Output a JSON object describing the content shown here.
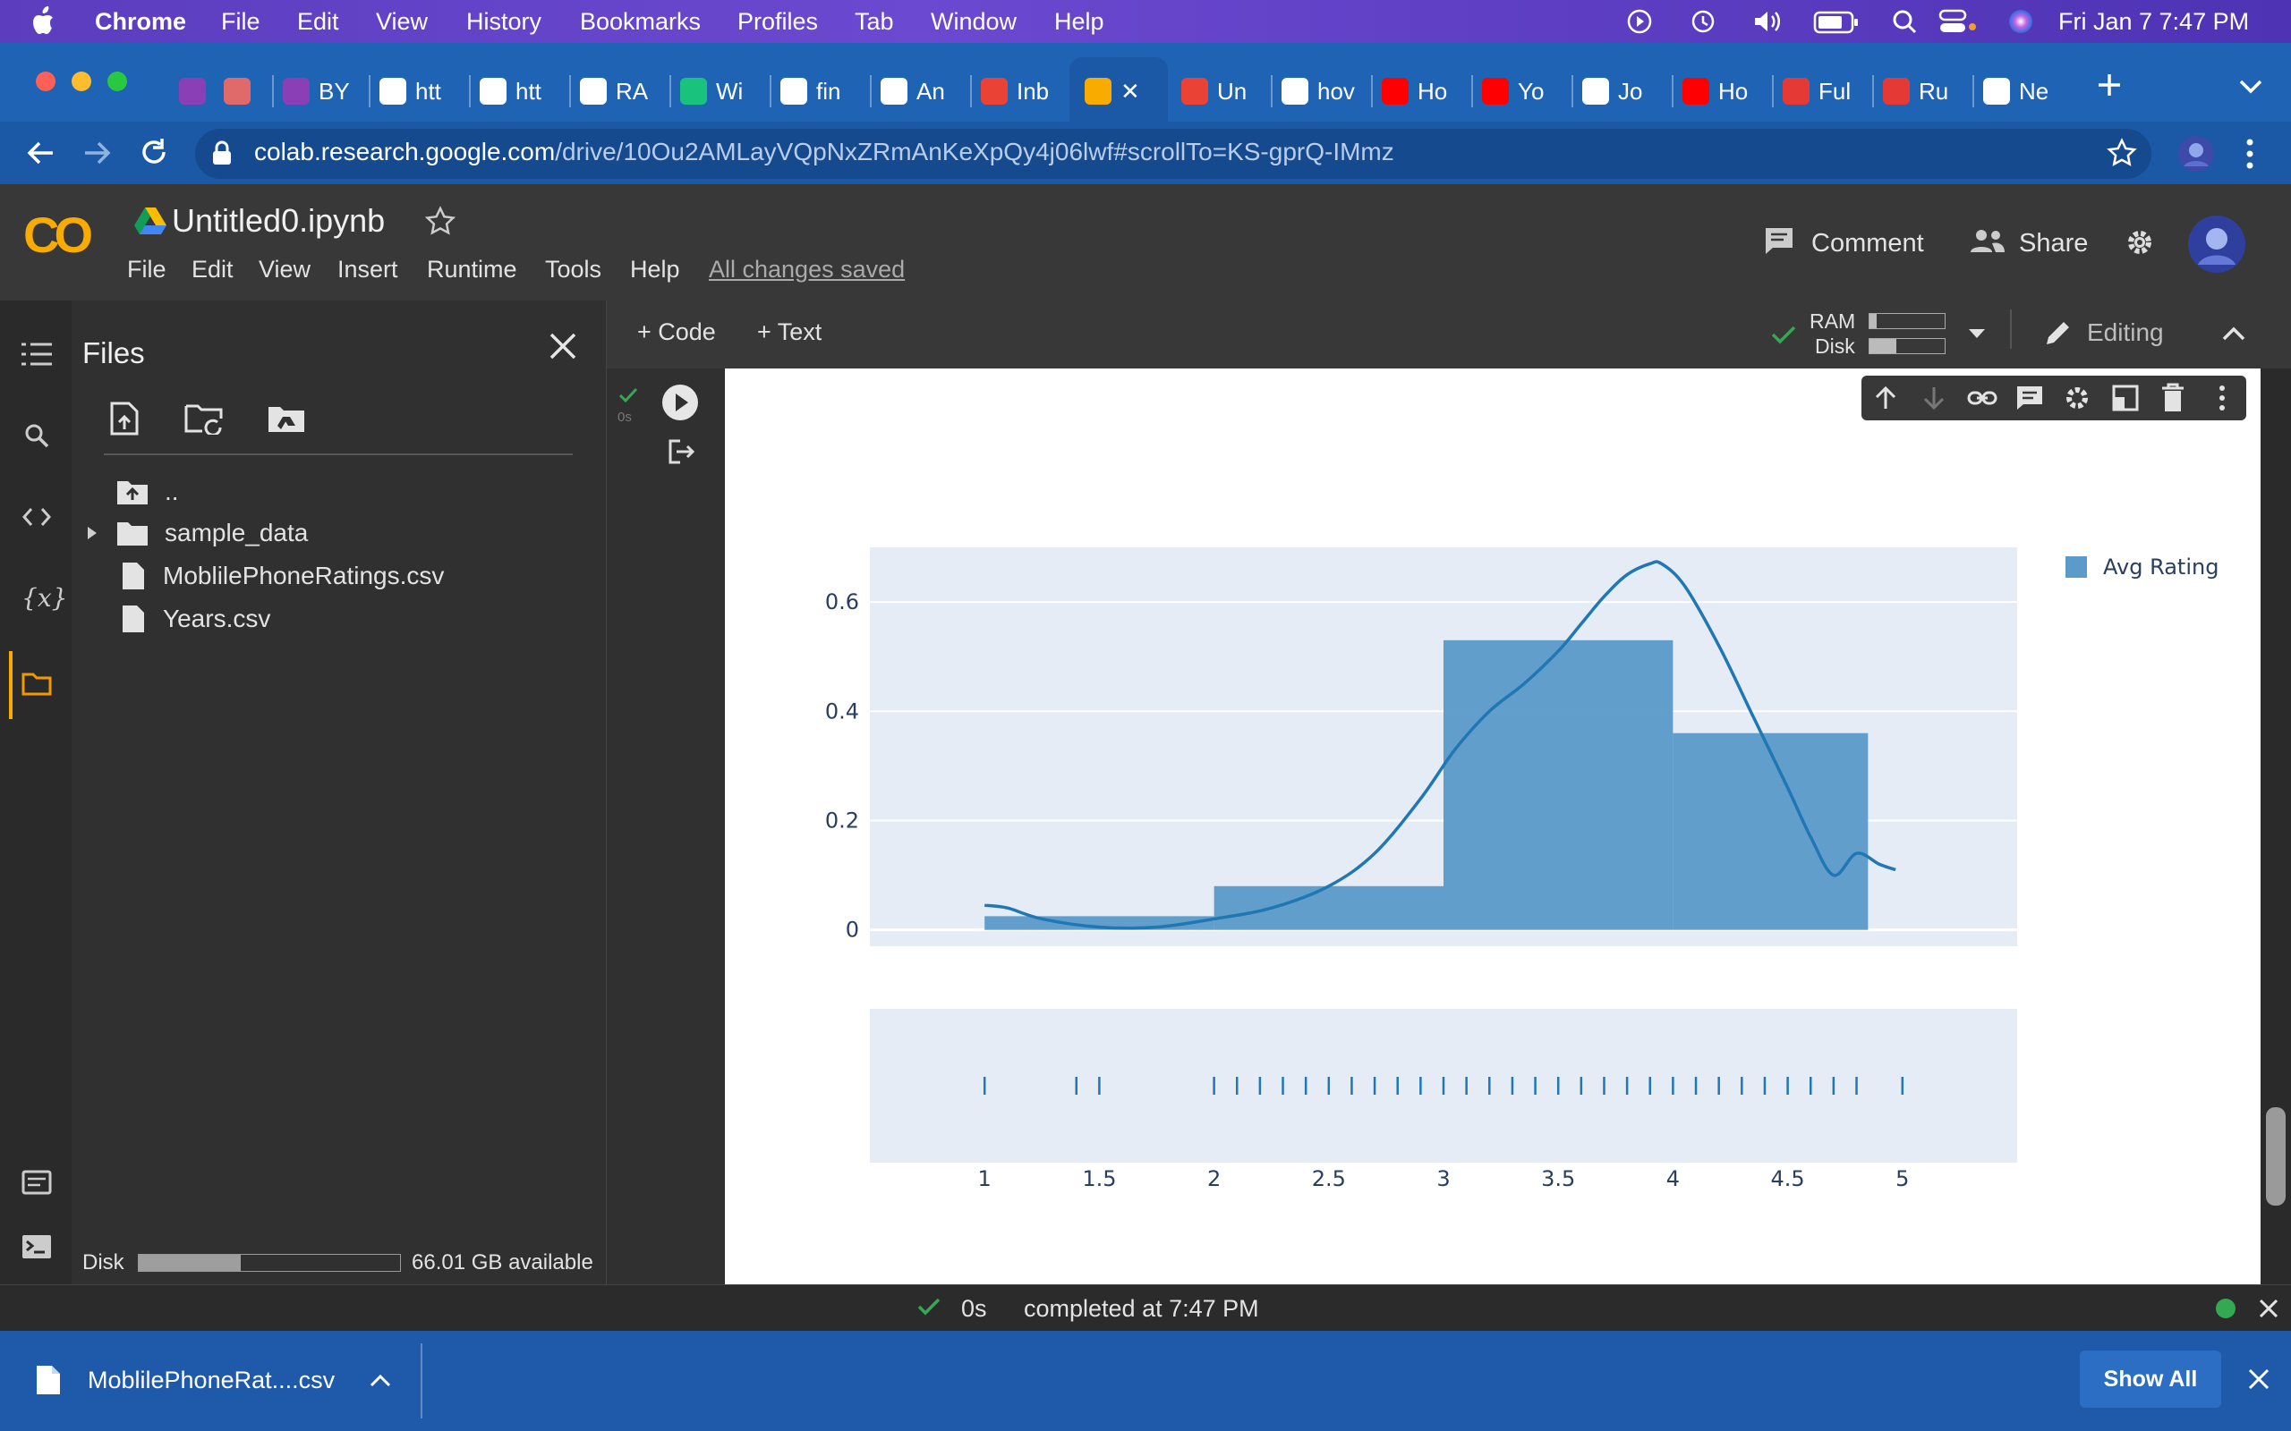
{
  "menubar": {
    "app": "Chrome",
    "items": [
      "File",
      "Edit",
      "View",
      "History",
      "Bookmarks",
      "Profiles",
      "Tab",
      "Window",
      "Help"
    ],
    "datetime": "Fri Jan 7  7:47 PM"
  },
  "tabs": [
    {
      "label": "",
      "color": "#8b3fb6"
    },
    {
      "label": "",
      "color": "#e06a6a"
    },
    {
      "label": "BY",
      "color": "#8b3fb6"
    },
    {
      "label": "htt",
      "color": "#ffffff"
    },
    {
      "label": "htt",
      "color": "#ffffff"
    },
    {
      "label": "RA",
      "color": "#ffffff"
    },
    {
      "label": "Wi",
      "color": "#19c37d"
    },
    {
      "label": "fin",
      "color": "#ffffff"
    },
    {
      "label": "An",
      "color": "#ffffff"
    },
    {
      "label": "Inb",
      "color": "#ea4335"
    },
    {
      "label": "",
      "color": "#f9ab00"
    },
    {
      "label": "Un",
      "color": "#ea4335"
    },
    {
      "label": "hov",
      "color": "#ffffff"
    },
    {
      "label": "Ho",
      "color": "#ff0000"
    },
    {
      "label": "Yo",
      "color": "#ff0000"
    },
    {
      "label": "Jo",
      "color": "#ffffff"
    },
    {
      "label": "Ho",
      "color": "#ff0000"
    },
    {
      "label": "Ful",
      "color": "#e53935"
    },
    {
      "label": "Ru",
      "color": "#e53935"
    },
    {
      "label": "Ne",
      "color": "#ffffff"
    }
  ],
  "address": {
    "host": "colab.research.google.com",
    "path": "/drive/10Ou2AMLayVQpNxZRmAnKeXpQy4j06lwf#scrollTo=KS-gprQ-IMmz"
  },
  "colab": {
    "logo": "CO",
    "notebook_title": "Untitled0.ipynb",
    "menu": [
      "File",
      "Edit",
      "View",
      "Insert",
      "Runtime",
      "Tools",
      "Help"
    ],
    "save_status": "All changes saved",
    "comment": "Comment",
    "share": "Share",
    "add_code": "+ Code",
    "add_text": "+ Text",
    "ram_label": "RAM",
    "disk_label": "Disk",
    "editing": "Editing"
  },
  "files_panel": {
    "title": "Files",
    "items": [
      {
        "name": "..",
        "type": "parent"
      },
      {
        "name": "sample_data",
        "type": "folder"
      },
      {
        "name": "MoblilePhoneRatings.csv",
        "type": "file"
      },
      {
        "name": "Years.csv",
        "type": "file"
      }
    ],
    "disk_label": "Disk",
    "disk_available": "66.01 GB available",
    "disk_used_fraction": 0.39
  },
  "cell": {
    "exec_time": "0s"
  },
  "chart_data": {
    "type": "bar",
    "subtype": "distplot (histogram + kde + rug)",
    "legend": [
      "Avg Rating"
    ],
    "legend_position": "top-right",
    "bins": [
      {
        "start": 1,
        "end": 2,
        "density": 0.025
      },
      {
        "start": 2,
        "end": 3,
        "density": 0.08
      },
      {
        "start": 3,
        "end": 4,
        "density": 0.53
      },
      {
        "start": 4,
        "end": 4.85,
        "density": 0.36
      }
    ],
    "kde": {
      "x": [
        1.0,
        1.1,
        1.25,
        1.5,
        1.75,
        2.0,
        2.25,
        2.5,
        2.7,
        2.9,
        3.05,
        3.2,
        3.35,
        3.5,
        3.6,
        3.7,
        3.8,
        3.9,
        3.95,
        4.05,
        4.2,
        4.35,
        4.5,
        4.6,
        4.7,
        4.8,
        4.9,
        4.97
      ],
      "y": [
        0.045,
        0.04,
        0.02,
        0.005,
        0.005,
        0.02,
        0.04,
        0.08,
        0.14,
        0.24,
        0.33,
        0.4,
        0.45,
        0.51,
        0.56,
        0.61,
        0.65,
        0.67,
        0.67,
        0.63,
        0.52,
        0.39,
        0.26,
        0.17,
        0.1,
        0.14,
        0.12,
        0.11
      ]
    },
    "rug": [
      1.0,
      1.4,
      1.5,
      2.0,
      2.1,
      2.2,
      2.3,
      2.4,
      2.5,
      2.6,
      2.7,
      2.8,
      2.9,
      3.0,
      3.1,
      3.2,
      3.3,
      3.4,
      3.5,
      3.6,
      3.7,
      3.8,
      3.9,
      4.0,
      4.1,
      4.2,
      4.3,
      4.4,
      4.5,
      4.6,
      4.7,
      4.8,
      5.0
    ],
    "xlim": [
      0.5,
      5.5
    ],
    "ylim": [
      -0.03,
      0.7
    ],
    "x_ticks": [
      "1",
      "1.5",
      "2",
      "2.5",
      "3",
      "3.5",
      "4",
      "4.5",
      "5"
    ],
    "x_tick_values": [
      1,
      1.5,
      2,
      2.5,
      3,
      3.5,
      4,
      4.5,
      5
    ],
    "y_ticks": [
      "0",
      "0.2",
      "0.4",
      "0.6"
    ],
    "y_tick_values": [
      0,
      0.2,
      0.4,
      0.6
    ],
    "colors": {
      "bar": "#5b9ac9",
      "line": "#1f77b4",
      "plot_bg": "#e5ecf6"
    }
  },
  "status": {
    "time": "0s",
    "message": "completed at 7:47 PM"
  },
  "download": {
    "filename": "MoblilePhoneRat....csv",
    "show_all": "Show All"
  }
}
